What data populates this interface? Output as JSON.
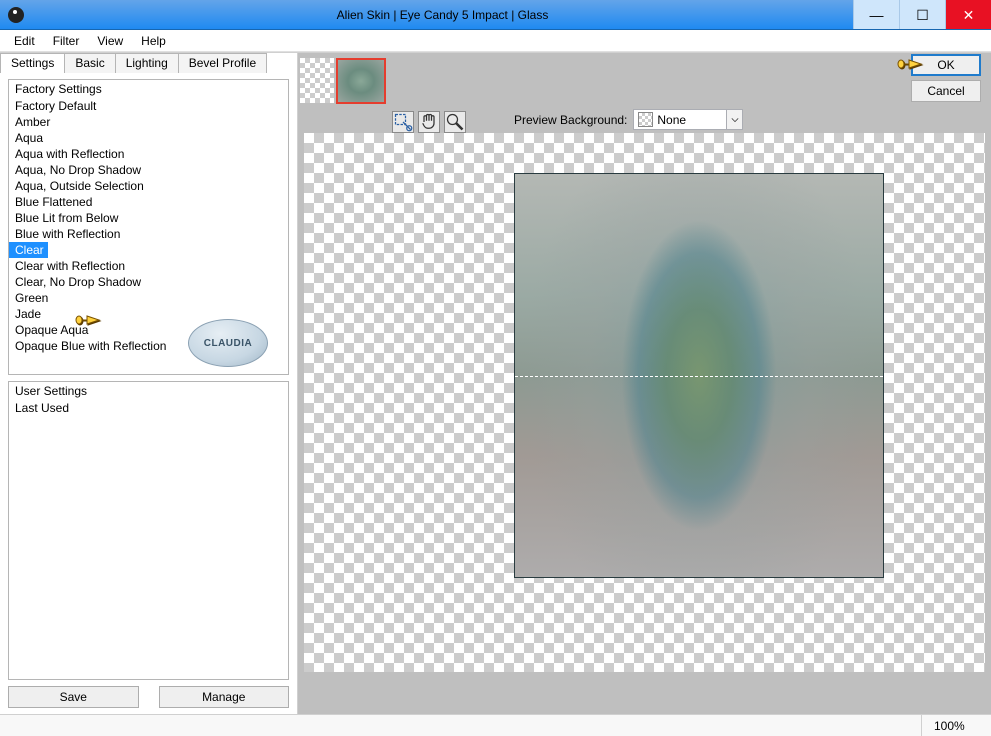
{
  "window": {
    "title": "Alien Skin | Eye Candy 5 Impact | Glass"
  },
  "menu": {
    "items": [
      "Edit",
      "Filter",
      "View",
      "Help"
    ]
  },
  "tabs": {
    "items": [
      "Settings",
      "Basic",
      "Lighting",
      "Bevel Profile"
    ],
    "active_index": 0
  },
  "factory_list": {
    "header": "Factory Settings",
    "items": [
      "Factory Default",
      "Amber",
      "Aqua",
      "Aqua with Reflection",
      "Aqua, No Drop Shadow",
      "Aqua, Outside Selection",
      "Blue Flattened",
      "Blue Lit from Below",
      "Blue with Reflection",
      "Clear",
      "Clear with Reflection",
      "Clear, No Drop Shadow",
      "Green",
      "Jade",
      "Opaque Aqua",
      "Opaque Blue with Reflection"
    ],
    "selected_index": 9
  },
  "user_list": {
    "header": "User Settings",
    "items": [
      "Last Used"
    ]
  },
  "buttons": {
    "save": "Save",
    "manage": "Manage",
    "ok": "OK",
    "cancel": "Cancel"
  },
  "preview": {
    "label": "Preview Background:",
    "selected": "None"
  },
  "status": {
    "zoom": "100%"
  },
  "watermark": "CLAUDIA"
}
